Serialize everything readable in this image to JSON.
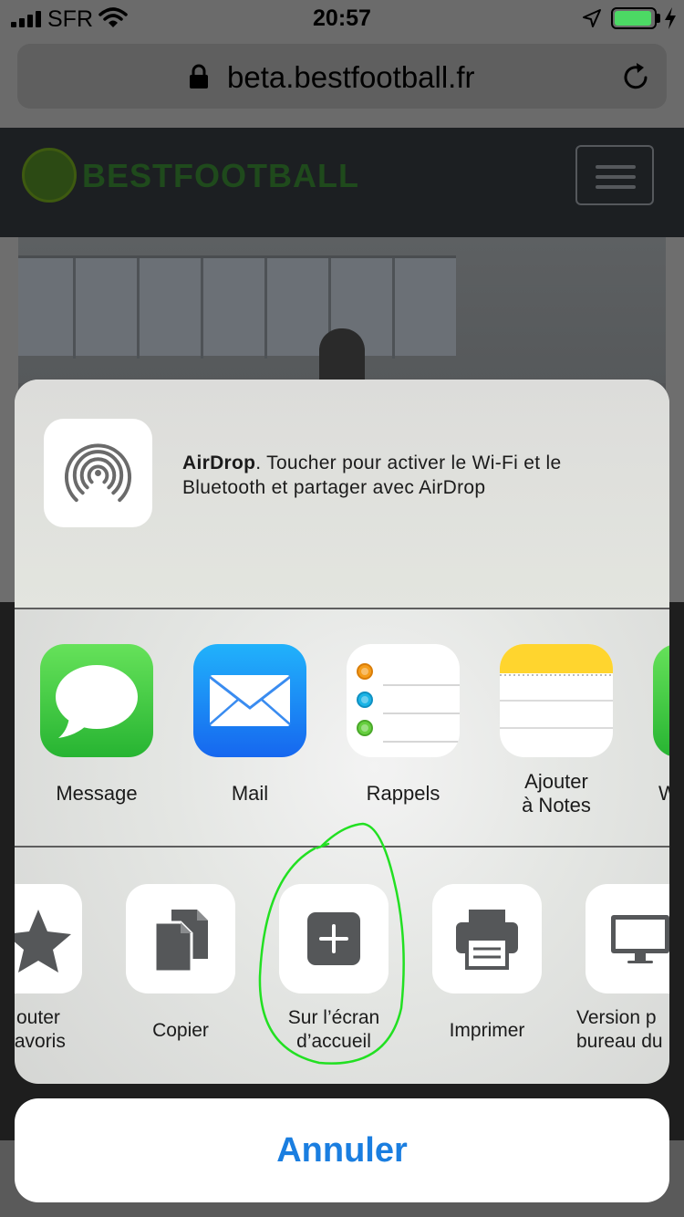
{
  "status_bar": {
    "carrier": "SFR",
    "time": "20:57",
    "battery_fraction": 0.95,
    "battery_color": "#4cd964",
    "icons": [
      "signal-icon",
      "wifi-icon",
      "location-arrow-icon",
      "battery-icon",
      "charging-bolt-icon"
    ]
  },
  "browser": {
    "url": "beta.bestfootball.fr",
    "icons": [
      "lock-icon",
      "reload-icon"
    ]
  },
  "website": {
    "logo_text": "BESTFOOTBALL",
    "menu_icon": "hamburger-menu-icon"
  },
  "share_sheet": {
    "airdrop": {
      "title": "AirDrop",
      "description": ". Toucher pour activer le Wi-Fi et le Bluetooth et partager avec AirDrop",
      "icon": "airdrop-icon"
    },
    "apps": [
      {
        "label": "Message",
        "icon": "messages-icon",
        "color": "#34c759"
      },
      {
        "label": "Mail",
        "icon": "mail-icon",
        "color": "#1f8ef1"
      },
      {
        "label": "Rappels",
        "icon": "reminders-icon",
        "color": "#ffffff"
      },
      {
        "label": "Ajouter\nà Notes",
        "label_line1": "Ajouter",
        "label_line2": "à Notes",
        "icon": "notes-icon",
        "color": "#ffd52e"
      },
      {
        "label": "W",
        "icon": "app-partial-icon",
        "color": "#34c759"
      }
    ],
    "actions": [
      {
        "label_line1": "outer",
        "label_line2": "favoris",
        "icon": "star-icon"
      },
      {
        "label": "Copier",
        "icon": "copy-icon"
      },
      {
        "label_line1": "Sur l’écran",
        "label_line2": "d’accueil",
        "icon": "add-to-home-icon",
        "highlighted": true,
        "highlight_color": "#22e022"
      },
      {
        "label": "Imprimer",
        "icon": "printer-icon"
      },
      {
        "label_line1": "Version p",
        "label_line2": "bureau du",
        "icon": "desktop-icon"
      }
    ]
  },
  "cancel": {
    "label": "Annuler",
    "color": "#1a7ee0"
  }
}
